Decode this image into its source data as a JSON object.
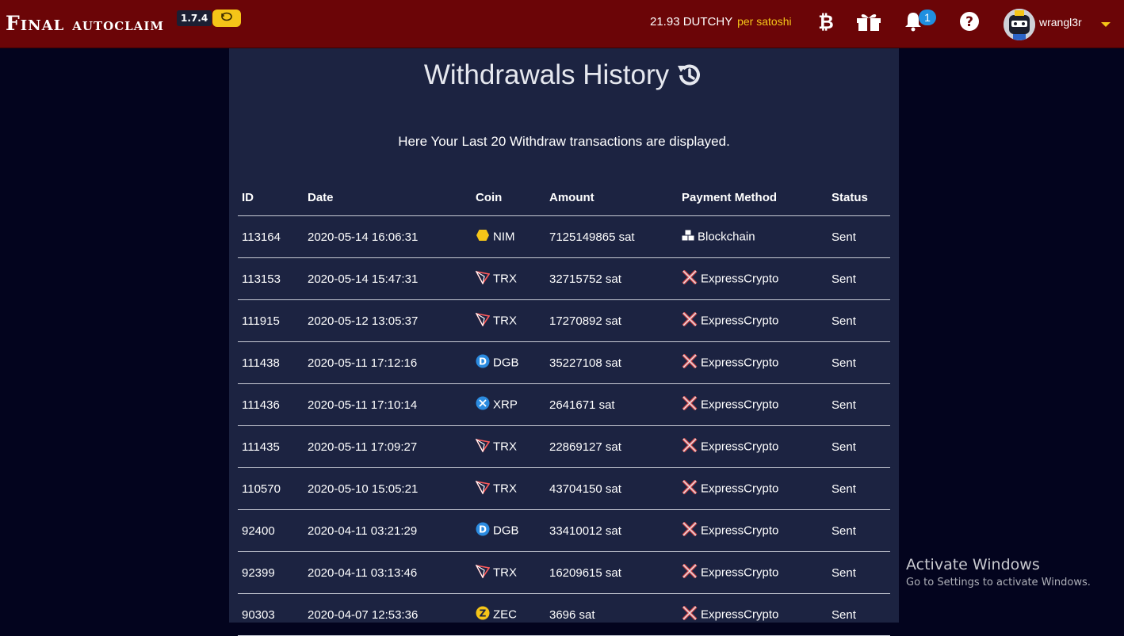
{
  "header": {
    "brand_word1": "Final",
    "brand_word2": "autoclaim",
    "version": "1.7.4",
    "rate_value": "21.93 DUTCHY",
    "rate_unit": "per satoshi",
    "notification_count": "1",
    "username": "wrangl3r"
  },
  "page": {
    "title": "Withdrawals History",
    "subtitle": "Here Your Last 20 Withdraw transactions are displayed."
  },
  "table": {
    "columns": [
      "ID",
      "Date",
      "Coin",
      "Amount",
      "Payment Method",
      "Status"
    ],
    "rows": [
      {
        "id": "113164",
        "date": "2020-05-14 16:06:31",
        "coin": "NIM",
        "coin_icon": "nim-icon",
        "amount": "7125149865 sat",
        "method": "Blockchain",
        "method_icon": "cubes-icon",
        "status": "Sent"
      },
      {
        "id": "113153",
        "date": "2020-05-14 15:47:31",
        "coin": "TRX",
        "coin_icon": "trx-icon",
        "amount": "32715752 sat",
        "method": "ExpressCrypto",
        "method_icon": "expresscrypto-icon",
        "status": "Sent"
      },
      {
        "id": "111915",
        "date": "2020-05-12 13:05:37",
        "coin": "TRX",
        "coin_icon": "trx-icon",
        "amount": "17270892 sat",
        "method": "ExpressCrypto",
        "method_icon": "expresscrypto-icon",
        "status": "Sent"
      },
      {
        "id": "111438",
        "date": "2020-05-11 17:12:16",
        "coin": "DGB",
        "coin_icon": "dgb-icon",
        "amount": "35227108 sat",
        "method": "ExpressCrypto",
        "method_icon": "expresscrypto-icon",
        "status": "Sent"
      },
      {
        "id": "111436",
        "date": "2020-05-11 17:10:14",
        "coin": "XRP",
        "coin_icon": "xrp-icon",
        "amount": "2641671 sat",
        "method": "ExpressCrypto",
        "method_icon": "expresscrypto-icon",
        "status": "Sent"
      },
      {
        "id": "111435",
        "date": "2020-05-11 17:09:27",
        "coin": "TRX",
        "coin_icon": "trx-icon",
        "amount": "22869127 sat",
        "method": "ExpressCrypto",
        "method_icon": "expresscrypto-icon",
        "status": "Sent"
      },
      {
        "id": "110570",
        "date": "2020-05-10 15:05:21",
        "coin": "TRX",
        "coin_icon": "trx-icon",
        "amount": "43704150 sat",
        "method": "ExpressCrypto",
        "method_icon": "expresscrypto-icon",
        "status": "Sent"
      },
      {
        "id": "92400",
        "date": "2020-04-11 03:21:29",
        "coin": "DGB",
        "coin_icon": "dgb-icon",
        "amount": "33410012 sat",
        "method": "ExpressCrypto",
        "method_icon": "expresscrypto-icon",
        "status": "Sent"
      },
      {
        "id": "92399",
        "date": "2020-04-11 03:13:46",
        "coin": "TRX",
        "coin_icon": "trx-icon",
        "amount": "16209615 sat",
        "method": "ExpressCrypto",
        "method_icon": "expresscrypto-icon",
        "status": "Sent"
      },
      {
        "id": "90303",
        "date": "2020-04-07 12:53:36",
        "coin": "ZEC",
        "coin_icon": "zec-icon",
        "amount": "3696 sat",
        "method": "ExpressCrypto",
        "method_icon": "expresscrypto-icon",
        "status": "Sent"
      }
    ]
  },
  "colors": {
    "topbar": "#6b0507",
    "page_background": "#03041e",
    "panel": "#1c2341",
    "accent_yellow": "#f5c518",
    "status_green": "#9be07a",
    "badge_blue": "#1f8fe0"
  },
  "watermark": {
    "line1": "Activate Windows",
    "line2": "Go to Settings to activate Windows."
  }
}
